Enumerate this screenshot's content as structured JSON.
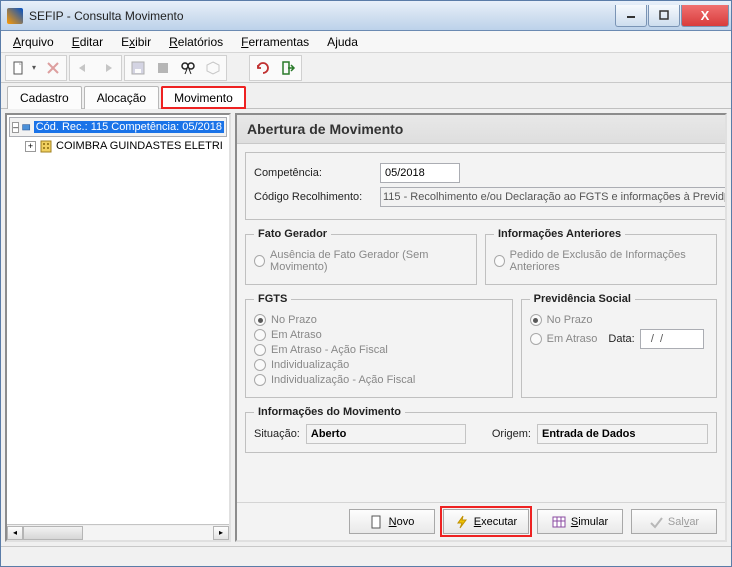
{
  "window": {
    "title": "SEFIP - Consulta Movimento"
  },
  "titlebuttons": {
    "close_label": "X"
  },
  "menu": {
    "items": [
      {
        "label": "Arquivo",
        "u": 0
      },
      {
        "label": "Editar",
        "u": 0
      },
      {
        "label": "Exibir",
        "u": 1
      },
      {
        "label": "Relatórios",
        "u": 0
      },
      {
        "label": "Ferramentas",
        "u": 0
      },
      {
        "label": "Ajuda",
        "u": 1
      }
    ]
  },
  "tabs": {
    "t0": "Cadastro",
    "t1": "Alocação",
    "t2": "Movimento"
  },
  "tree": {
    "root_label": "Cód. Rec.: 115 Competência: 05/2018",
    "child_label": "COIMBRA GUINDASTES ELETRI"
  },
  "form": {
    "title": "Abertura de Movimento",
    "competencia_label": "Competência:",
    "competencia_value": "05/2018",
    "cod_rec_label": "Código Recolhimento:",
    "cod_rec_value": "115 - Recolhimento e/ou Declaração ao FGTS e informações à Previd",
    "fato_legend": "Fato Gerador",
    "fato_opt": "Ausência de Fato Gerador (Sem Movimento)",
    "infoant_legend": "Informações Anteriores",
    "infoant_opt": "Pedido de Exclusão de Informações Anteriores",
    "fgts_legend": "FGTS",
    "fgts0": "No Prazo",
    "fgts1": "Em Atraso",
    "fgts2": "Em Atraso - Ação Fiscal",
    "fgts3": "Individualização",
    "fgts4": "Individualização - Ação Fiscal",
    "prev_legend": "Previdência Social",
    "prev0": "No Prazo",
    "prev1": "Em Atraso",
    "prev_data_label": "Data:",
    "prev_data_value": "  /  /",
    "infomov_legend": "Informações do Movimento",
    "situacao_label": "Situação:",
    "situacao_value": "Aberto",
    "origem_label": "Origem:",
    "origem_value": "Entrada de Dados"
  },
  "buttons": {
    "novo": "Novo",
    "executar": "Executar",
    "simular": "Simular",
    "salvar": "Salvar"
  }
}
